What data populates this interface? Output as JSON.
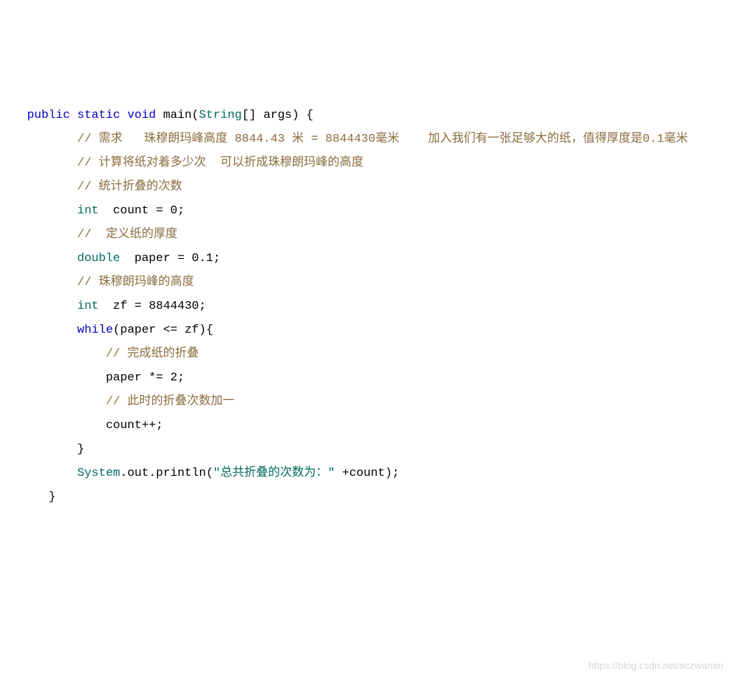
{
  "code": {
    "l1": {
      "kw_public": "public",
      "kw_static": "static",
      "kw_void": "void",
      "fn_main": "main",
      "cls_string": "String",
      "arr": "[]",
      "arg": "args",
      "brace": "{"
    },
    "l2": {
      "comment": "// 需求   珠穆朗玛峰高度 8844.43 米 = 8844430毫米    加入我们有一张足够大的纸，值得厚度是0.1毫米"
    },
    "l3": {
      "comment": "// 计算将纸对着多少次  可以折成珠穆朗玛峰的高度"
    },
    "l4": {
      "comment": "// 统计折叠的次数"
    },
    "l5": {
      "kw_int": "int",
      "ident": "count",
      "eq": "=",
      "val": "0",
      "semi": ";"
    },
    "l6": {
      "comment": "//  定义纸的厚度"
    },
    "l7": {
      "kw_double": "double",
      "ident": "paper",
      "eq": "=",
      "val": "0.1",
      "semi": ";"
    },
    "l8": {
      "comment": "// 珠穆朗玛峰的高度"
    },
    "l9": {
      "kw_int": "int",
      "ident": "zf",
      "eq": "=",
      "val": "8844430",
      "semi": ";"
    },
    "l10": {
      "kw_while": "while",
      "lparen": "(",
      "ident_paper": "paper",
      "op": "<=",
      "ident_zf": "zf",
      "rparen": ")",
      "brace": "{"
    },
    "l11": {
      "comment": "// 完成纸的折叠"
    },
    "l12": {
      "ident": "paper",
      "op": "*=",
      "val": "2",
      "semi": ";"
    },
    "l13": {
      "comment": "// 此时的折叠次数加一"
    },
    "l14": {
      "ident": "count",
      "op": "++",
      "semi": ";"
    },
    "l15": {
      "brace": "}"
    },
    "l16": {
      "cls_system": "System",
      "dot1": ".",
      "out": "out",
      "dot2": ".",
      "println": "println",
      "lparen": "(",
      "str": "\"总共折叠的次数为：\"",
      "plus": " +",
      "ident": "count",
      "rparen": ")",
      "semi": ";"
    },
    "l17": {
      "brace": "}"
    }
  },
  "watermark": "https://blog.csdn.net/aczwanan"
}
